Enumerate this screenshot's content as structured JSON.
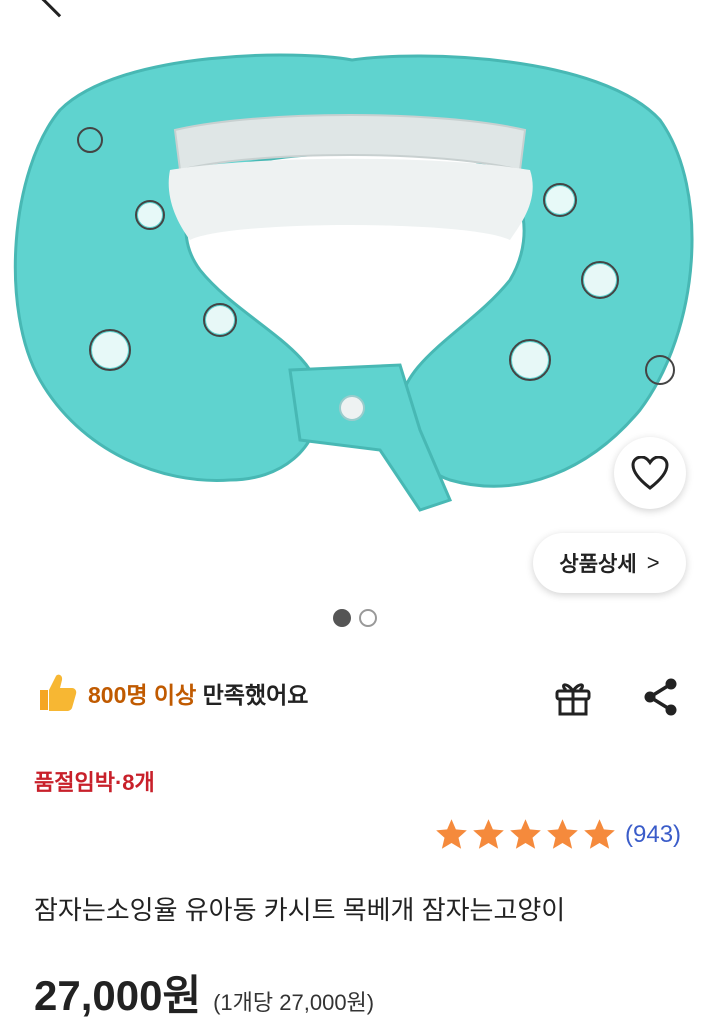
{
  "hero": {
    "image_description": "",
    "detail_button_label": "상품상세",
    "detail_button_chevron": ">",
    "dots_count": 2,
    "active_dot": 0
  },
  "satisfaction": {
    "count_text": "800명 이상",
    "suffix_text": "만족했어요"
  },
  "stock": {
    "text": "품절임박·8개"
  },
  "rating": {
    "stars": 5,
    "review_count": "(943)"
  },
  "product": {
    "title": "잠자는소잉율 유아동 카시트 목베개 잠자는고양이",
    "price": "27,000원",
    "unit_price": "(1개당 27,000원)"
  },
  "colors": {
    "pillow": "#5fd3cf",
    "highlight": "#c05a00",
    "stock": "#c8202a",
    "star": "#f58a3c",
    "review_link": "#3a5cc9"
  }
}
